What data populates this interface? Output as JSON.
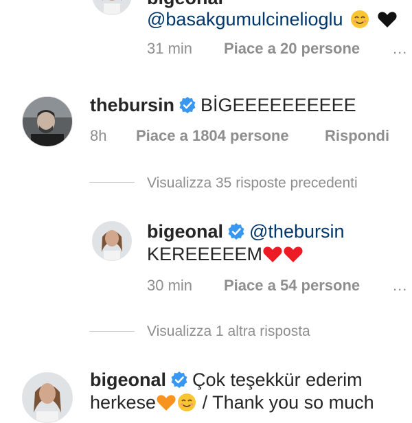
{
  "comments": {
    "reply_top": {
      "username_partial": "bigeonal",
      "mention": "@basakgumulcinelioglu",
      "time": "31 min",
      "likes": "Piace a 20 persone",
      "more": "..."
    },
    "bursin": {
      "username": "thebursin",
      "text": "BİGEEEEEEEEEE",
      "time": "8h",
      "likes": "Piace a 1804 persone",
      "reply": "Rispondi"
    },
    "view_previous": "Visualizza 35 risposte precedenti",
    "reply_bige": {
      "username": "bigeonal",
      "mention": "@thebursin",
      "text": "KEREEEEEM",
      "time": "30 min",
      "likes": "Piace a 54 persone",
      "more": "..."
    },
    "view_more": "Visualizza 1 altra risposta",
    "bige_main": {
      "username": "bigeonal",
      "text_line1": "Çok teşekkür ederim",
      "text_line2_a": "herkese",
      "text_line2_b": " / Thank you so much"
    }
  },
  "colors": {
    "verified": "#3897f0",
    "link": "#00376b",
    "muted": "#8e8e8e",
    "heart": "#ed1c24",
    "orange_heart": "#f7931e",
    "smile": "#f9c533"
  }
}
